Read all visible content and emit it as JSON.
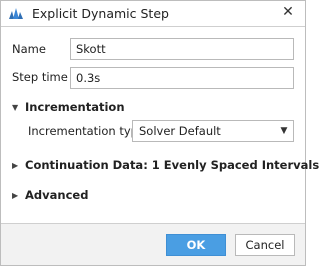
{
  "window": {
    "title": "Explicit Dynamic Step",
    "app_icon": "abaqus-triangle-icon",
    "close_icon": "close-icon"
  },
  "form": {
    "name_label": "Name",
    "name_value": "Skott",
    "step_time_label": "Step time",
    "step_time_value": "0.3s"
  },
  "sections": {
    "incrementation": {
      "title": "Incrementation",
      "expanded": true,
      "type_label": "Incrementation type",
      "type_value": "Solver Default"
    },
    "continuation": {
      "title": "Continuation Data:  1 Evenly Spaced Intervals",
      "expanded": false
    },
    "advanced": {
      "title": "Advanced",
      "expanded": false
    }
  },
  "buttons": {
    "ok_label": "OK",
    "cancel_label": "Cancel"
  },
  "colors": {
    "accent": "#4a9ee3",
    "footer_bg": "#f2f2f2"
  }
}
